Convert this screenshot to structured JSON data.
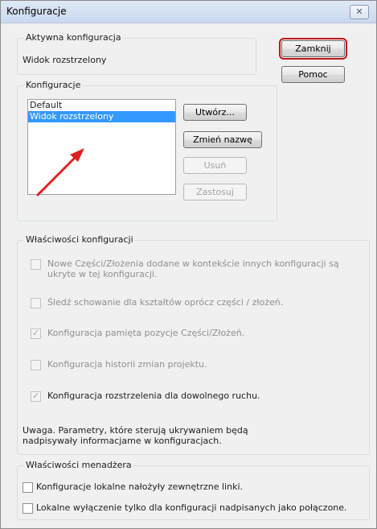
{
  "window": {
    "title": "Konfiguracje",
    "close_glyph": "✕"
  },
  "active_config": {
    "legend": "Aktywna konfiguracja",
    "value": "Widok rozstrzelony"
  },
  "buttons": {
    "close_label": "Zamknij",
    "help_label": "Pomoc",
    "create_label": "Utwórz...",
    "rename_label": "Zmień nazwę",
    "delete_label": "Usuń",
    "apply_label": "Zastosuj"
  },
  "configs": {
    "legend": "Konfiguracje",
    "items": [
      "Default",
      "Widok rozstrzelony"
    ],
    "selected_index": 1
  },
  "config_properties": {
    "legend": "Właściwości konfiguracji",
    "options": [
      {
        "label": "Nowe Części/Złożenia dodane w kontekście innych konfiguracji są ukryte w tej konfiguracji.",
        "checked": false,
        "enabled": false
      },
      {
        "label": "Śledź schowanie dla kształtów oprócz części / złożeń.",
        "checked": false,
        "enabled": false
      },
      {
        "label": "Konfiguracja pamięta pozycje Części/Złożeń.",
        "checked": true,
        "enabled": false
      },
      {
        "label": "Konfiguracja historii zmian projektu.",
        "checked": false,
        "enabled": false
      },
      {
        "label": "Konfiguracja rozstrzelenia dla dowolnego ruchu.",
        "checked": true,
        "enabled": true
      }
    ],
    "note": "Uwaga. Parametry, które sterują ukrywaniem będą nadpisywały informacjame w konfiguracjach."
  },
  "manager_properties": {
    "legend": "Właściwości menadżera",
    "options": [
      {
        "label": "Konfiguracje lokalne nałożyły zewnętrzne linki.",
        "checked": false,
        "enabled": true
      },
      {
        "label": "Lokalne wyłączenie tylko dla konfiguracji nadpisanych jako połączone.",
        "checked": false,
        "enabled": true
      }
    ]
  },
  "colors": {
    "selection": "#3399ff",
    "default_button_highlight": "#c0161c",
    "annotation_arrow": "#e02020"
  }
}
